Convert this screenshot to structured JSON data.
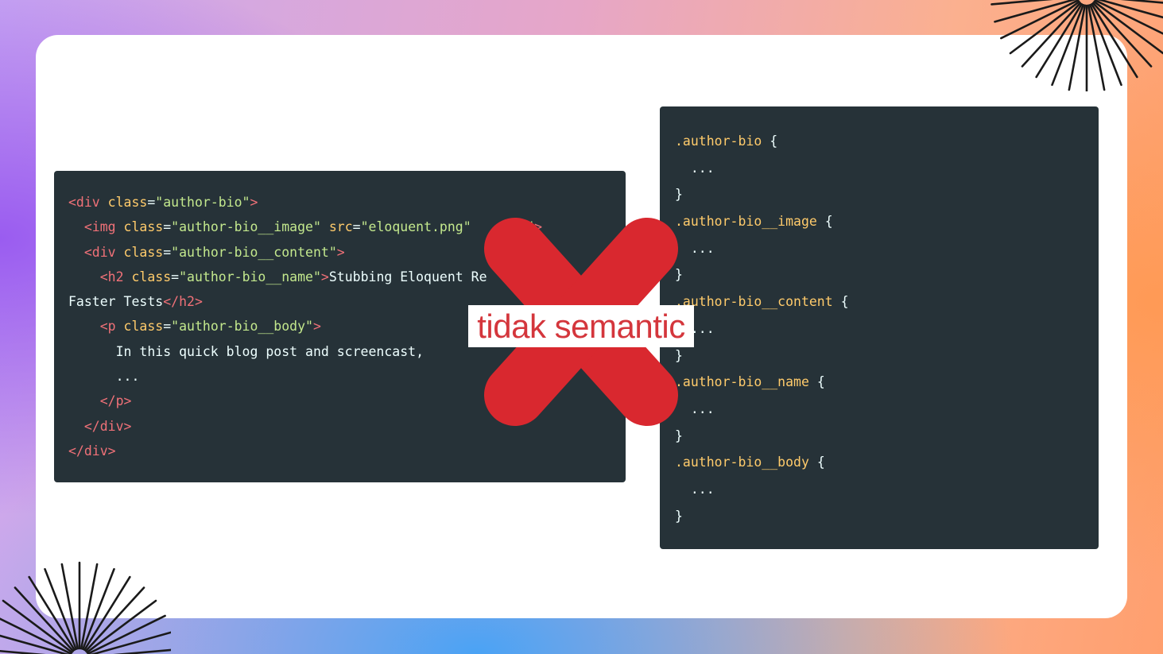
{
  "label": "tidak semantic",
  "html_block": {
    "lines": [
      [
        {
          "c": "tag",
          "t": "<div "
        },
        {
          "c": "attr",
          "t": "class"
        },
        {
          "c": "txt",
          "t": "="
        },
        {
          "c": "str",
          "t": "\"author-bio\""
        },
        {
          "c": "tag",
          "t": ">"
        }
      ],
      [
        {
          "c": "tag",
          "t": "  <img "
        },
        {
          "c": "attr",
          "t": "class"
        },
        {
          "c": "txt",
          "t": "="
        },
        {
          "c": "str",
          "t": "\"author-bio__image\""
        },
        {
          "c": "txt",
          "t": " "
        },
        {
          "c": "attr",
          "t": "src"
        },
        {
          "c": "txt",
          "t": "="
        },
        {
          "c": "str",
          "t": "\"eloquent.png\""
        },
        {
          "c": "txt",
          "t": "      "
        },
        {
          "c": "str",
          "t": "\"\""
        },
        {
          "c": "tag",
          "t": ">"
        }
      ],
      [
        {
          "c": "tag",
          "t": "  <div "
        },
        {
          "c": "attr",
          "t": "class"
        },
        {
          "c": "txt",
          "t": "="
        },
        {
          "c": "str",
          "t": "\"author-bio__content\""
        },
        {
          "c": "tag",
          "t": ">"
        }
      ],
      [
        {
          "c": "tag",
          "t": "    <h2 "
        },
        {
          "c": "attr",
          "t": "class"
        },
        {
          "c": "txt",
          "t": "="
        },
        {
          "c": "str",
          "t": "\"author-bio__name\""
        },
        {
          "c": "tag",
          "t": ">"
        },
        {
          "c": "txt",
          "t": "Stubbing Eloquent Re"
        }
      ],
      [
        {
          "c": "txt",
          "t": "Faster Tests"
        },
        {
          "c": "tag",
          "t": "</h2>"
        }
      ],
      [
        {
          "c": "tag",
          "t": "    <p "
        },
        {
          "c": "attr",
          "t": "class"
        },
        {
          "c": "txt",
          "t": "="
        },
        {
          "c": "str",
          "t": "\"author-bio__body\""
        },
        {
          "c": "tag",
          "t": ">"
        }
      ],
      [
        {
          "c": "txt",
          "t": "      In this quick blog post and screencast,"
        }
      ],
      [
        {
          "c": "txt",
          "t": "      ..."
        }
      ],
      [
        {
          "c": "tag",
          "t": "    </p>"
        }
      ],
      [
        {
          "c": "tag",
          "t": "  </div>"
        }
      ],
      [
        {
          "c": "tag",
          "t": "</div>"
        }
      ]
    ]
  },
  "css_block": {
    "lines": [
      [
        {
          "c": "sel",
          "t": ".author-bio"
        },
        {
          "c": "brace",
          "t": " {"
        }
      ],
      [
        {
          "c": "txt",
          "t": "  ..."
        }
      ],
      [
        {
          "c": "brace",
          "t": "}"
        }
      ],
      [
        {
          "c": "sel",
          "t": ".author-bio__image"
        },
        {
          "c": "brace",
          "t": " {"
        }
      ],
      [
        {
          "c": "txt",
          "t": "  ..."
        }
      ],
      [
        {
          "c": "brace",
          "t": "}"
        }
      ],
      [
        {
          "c": "sel",
          "t": ".author-bio__content"
        },
        {
          "c": "brace",
          "t": " {"
        }
      ],
      [
        {
          "c": "txt",
          "t": "  ..."
        }
      ],
      [
        {
          "c": "brace",
          "t": "}"
        }
      ],
      [
        {
          "c": "sel",
          "t": ".author-bio__name"
        },
        {
          "c": "brace",
          "t": " {"
        }
      ],
      [
        {
          "c": "txt",
          "t": "  ..."
        }
      ],
      [
        {
          "c": "brace",
          "t": "}"
        }
      ],
      [
        {
          "c": "sel",
          "t": ".author-bio__body"
        },
        {
          "c": "brace",
          "t": " {"
        }
      ],
      [
        {
          "c": "txt",
          "t": "  ..."
        }
      ],
      [
        {
          "c": "brace",
          "t": "}"
        }
      ]
    ]
  },
  "colors": {
    "code_bg": "#263238",
    "tag": "#f07178",
    "attr": "#ffcb6b",
    "string": "#c3e88d",
    "cross": "#d9282f",
    "label_text": "#d4363c"
  },
  "icons": [
    "red-cross-icon",
    "sunburst-decoration-icon"
  ]
}
